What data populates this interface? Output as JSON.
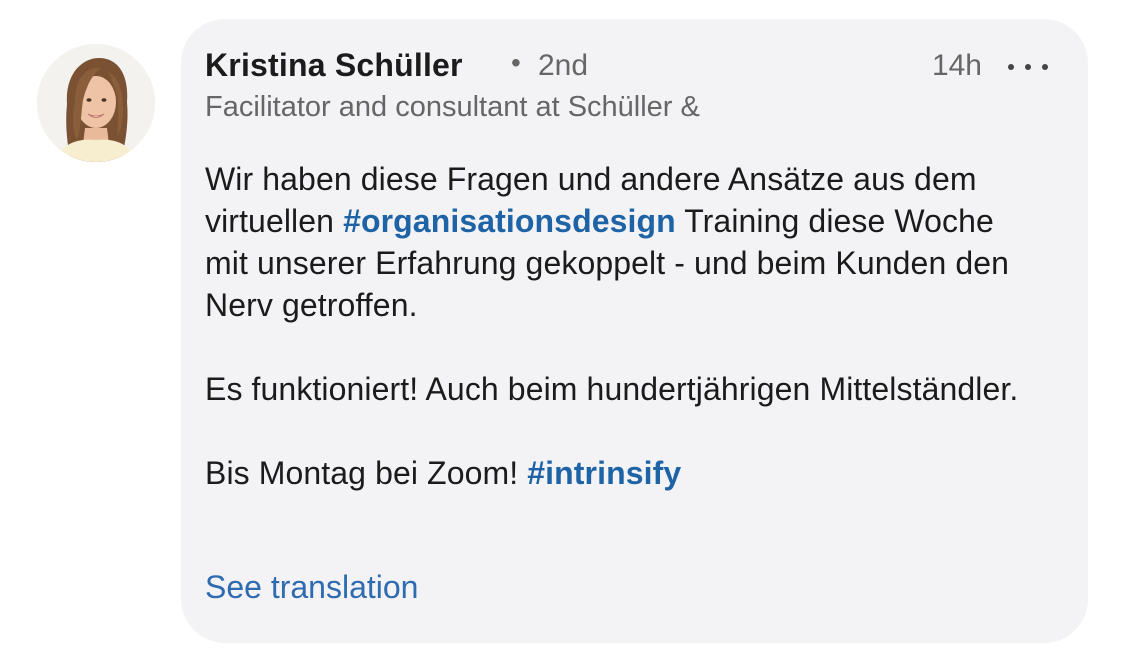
{
  "comment": {
    "author": {
      "name": "Kristina Schüller",
      "separator": "•",
      "degree": "2nd",
      "headline": "Facilitator and consultant at Schüller &"
    },
    "timestamp": "14h",
    "more_icon": "more-horizontal-icon",
    "body": {
      "p1_part1": "Wir haben diese Fragen und andere Ansätze aus dem virtuellen ",
      "p1_hashtag": "#organisationsdesign",
      "p1_part2": " Training diese Woche mit unserer Erfahrung gekoppelt - und beim Kunden den Nerv getroffen.",
      "p2": "Es funktioniert! Auch beim hundertjährigen Mittelständler.",
      "p3_part1": "Bis Montag bei Zoom! ",
      "p3_hashtag": "#intrinsify"
    },
    "see_translation": "See translation"
  },
  "colors": {
    "bubble_background": "#f3f3f5",
    "hashtag": "#1e63a6",
    "link": "#2e6bb0",
    "secondary_text": "#666666"
  }
}
